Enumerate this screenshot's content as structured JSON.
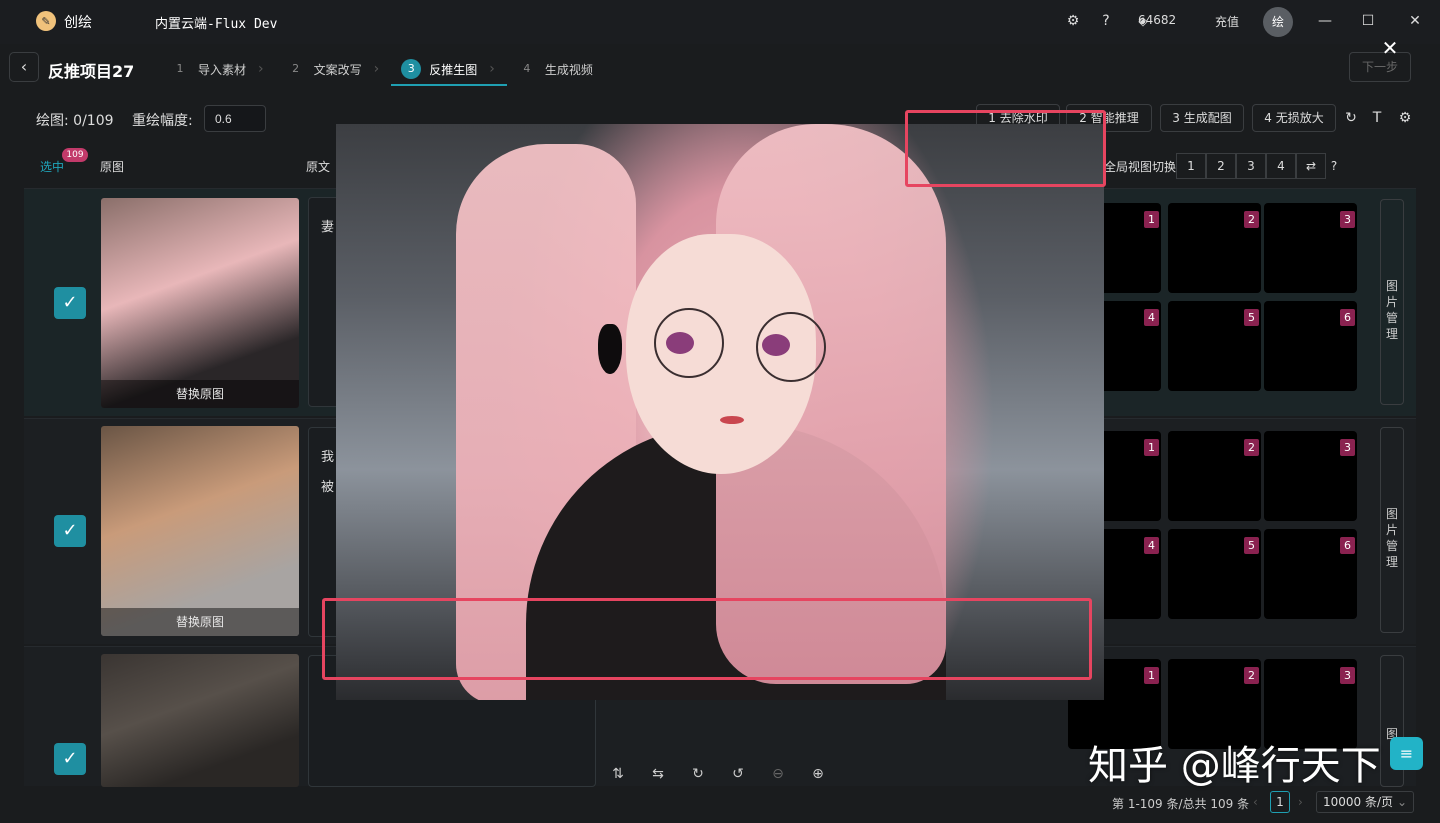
{
  "titlebar": {
    "app_name": "创绘",
    "engine": "内置云端-Flux Dev",
    "credits": "64682",
    "recharge": "充值",
    "avatar": "绘"
  },
  "project": {
    "title": "反推项目27",
    "steps": [
      {
        "num": "1",
        "label": "导入素材"
      },
      {
        "num": "2",
        "label": "文案改写"
      },
      {
        "num": "3",
        "label": "反推生图"
      },
      {
        "num": "4",
        "label": "生成视频"
      }
    ],
    "next": "下一步"
  },
  "controls": {
    "draw_count": "绘图: 0/109",
    "redraw_label": "重绘幅度:",
    "redraw_value": "0.6",
    "actions": [
      "1 去除水印",
      "2 智能推理",
      "3 生成配图",
      "4 无损放大"
    ]
  },
  "table": {
    "col_selected": "选中",
    "selected_badge": "109",
    "col_original": "原图",
    "col_text": "原文",
    "global_switch": "全局视图切换",
    "view_options": [
      "1",
      "2",
      "3",
      "4"
    ],
    "replace_label": "替换原图",
    "image_manage": [
      "图",
      "片",
      "管",
      "理"
    ],
    "cell_numbers": [
      "1",
      "2",
      "3",
      "4",
      "5",
      "6"
    ],
    "rows": [
      {
        "index": "0",
        "text": [
          "妻"
        ]
      },
      {
        "index": "1",
        "text": [
          "我",
          "被"
        ]
      },
      {
        "index": "2",
        "text": []
      }
    ]
  },
  "watermark": "知乎 @峰行天下",
  "pagination": {
    "info": "第 1-109 条/总共 109 条",
    "current": "1",
    "page_size": "10000 条/页"
  }
}
